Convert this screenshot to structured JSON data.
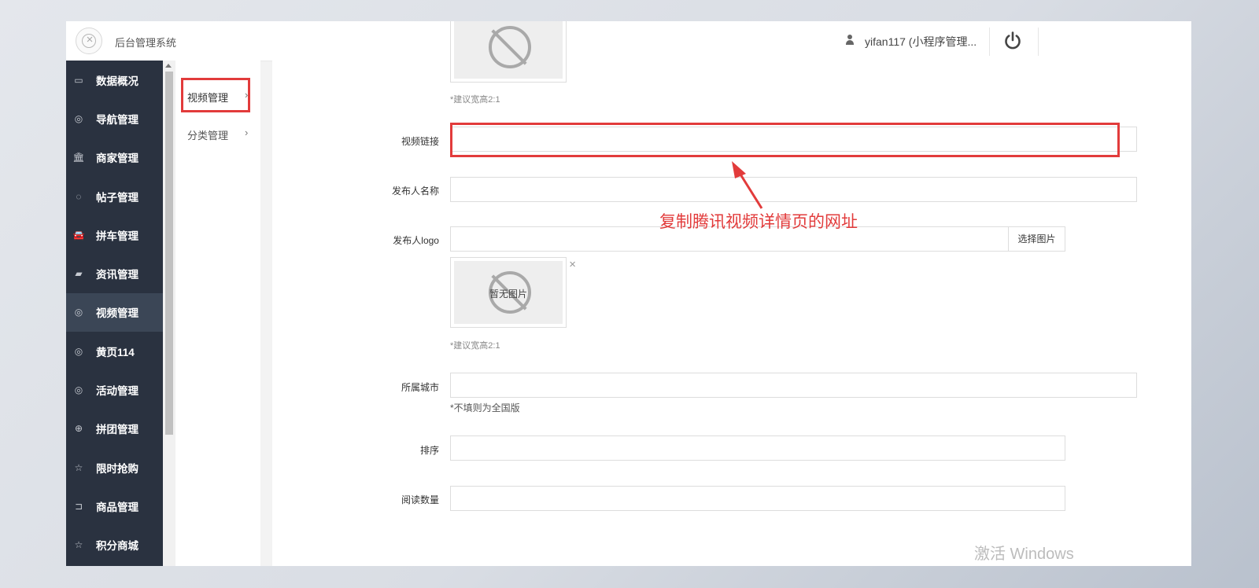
{
  "header": {
    "app_title": "后台管理系统",
    "user_name": "yifan117 (小程序管理..."
  },
  "sidebar": {
    "items": [
      {
        "label": "数据概况",
        "icon": "dashboard-icon",
        "glyph": "▭"
      },
      {
        "label": "导航管理",
        "icon": "compass-icon",
        "glyph": "◎"
      },
      {
        "label": "商家管理",
        "icon": "bank-icon",
        "glyph": "🏛"
      },
      {
        "label": "帖子管理",
        "icon": "comment-icon",
        "glyph": "◌"
      },
      {
        "label": "拼车管理",
        "icon": "car-icon",
        "glyph": "🚘"
      },
      {
        "label": "资讯管理",
        "icon": "book-icon",
        "glyph": "▰"
      },
      {
        "label": "视频管理",
        "icon": "compass-icon",
        "glyph": "◎"
      },
      {
        "label": "黄页114",
        "icon": "compass-icon",
        "glyph": "◎"
      },
      {
        "label": "活动管理",
        "icon": "compass-icon",
        "glyph": "◎"
      },
      {
        "label": "拼团管理",
        "icon": "lifebuoy-icon",
        "glyph": "⊕"
      },
      {
        "label": "限时抢购",
        "icon": "star-icon",
        "glyph": "☆"
      },
      {
        "label": "商品管理",
        "icon": "cart-icon",
        "glyph": "⊐"
      },
      {
        "label": "积分商城",
        "icon": "star-icon",
        "glyph": "☆"
      }
    ],
    "active_index": 6
  },
  "subnav": {
    "items": [
      {
        "label": "视频管理",
        "chevron": "›"
      },
      {
        "label": "分类管理",
        "chevron": "›"
      }
    ]
  },
  "form": {
    "top_hint": "*建议宽高2:1",
    "video_link_label": "视频链接",
    "video_link_value": "",
    "publisher_name_label": "发布人名称",
    "publisher_name_value": "",
    "publisher_logo_label": "发布人logo",
    "publisher_logo_value": "",
    "select_image_button": "选择图片",
    "no_image_text": "暂无图片",
    "close_glyph": "×",
    "logo_hint": "*建议宽高2:1",
    "city_label": "所属城市",
    "city_value": "",
    "city_hint": "*不填则为全国版",
    "sort_label": "排序",
    "sort_value": "",
    "read_count_label": "阅读数量",
    "read_count_value": ""
  },
  "annotation": {
    "text": "复制腾讯视频详情页的网址",
    "color": "#e23b3b"
  },
  "watermark": {
    "text": "激活 Windows"
  }
}
